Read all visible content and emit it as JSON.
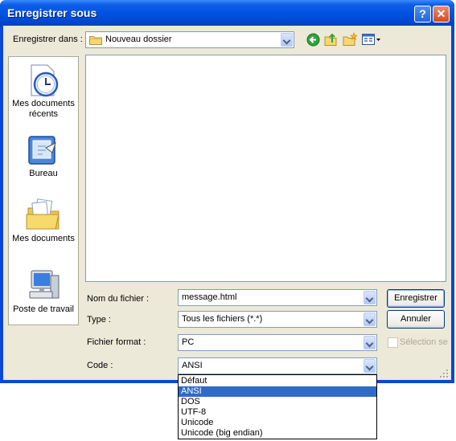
{
  "window": {
    "title": "Enregistrer sous"
  },
  "save_in": {
    "label": "Enregistrer dans :",
    "value": "Nouveau dossier"
  },
  "places": [
    {
      "name": "recent",
      "label_lines": [
        "Mes documents",
        "récents"
      ]
    },
    {
      "name": "desktop",
      "label_lines": [
        "Bureau"
      ]
    },
    {
      "name": "mydocs",
      "label_lines": [
        "Mes documents"
      ]
    },
    {
      "name": "mycomputer",
      "label_lines": [
        "Poste de travail"
      ]
    }
  ],
  "form": {
    "filename": {
      "label": "Nom du fichier :",
      "value": "message.html"
    },
    "type": {
      "label": "Type :",
      "value": "Tous les fichiers (*.*)"
    },
    "format": {
      "label": "Fichier format :",
      "value": "PC"
    },
    "encoding": {
      "label": "Code :",
      "value": "ANSI"
    }
  },
  "buttons": {
    "save": "Enregistrer",
    "cancel": "Annuler"
  },
  "readonly": {
    "label": "Sélection seu"
  },
  "encoding_options": [
    "Défaut",
    "ANSI",
    "DOS",
    "UTF-8",
    "Unicode",
    "Unicode (big endian)"
  ],
  "encoding_selected_index": 1,
  "colors": {
    "title_blue": "#0054e3",
    "face": "#ece9d8",
    "selection": "#316ac5"
  }
}
